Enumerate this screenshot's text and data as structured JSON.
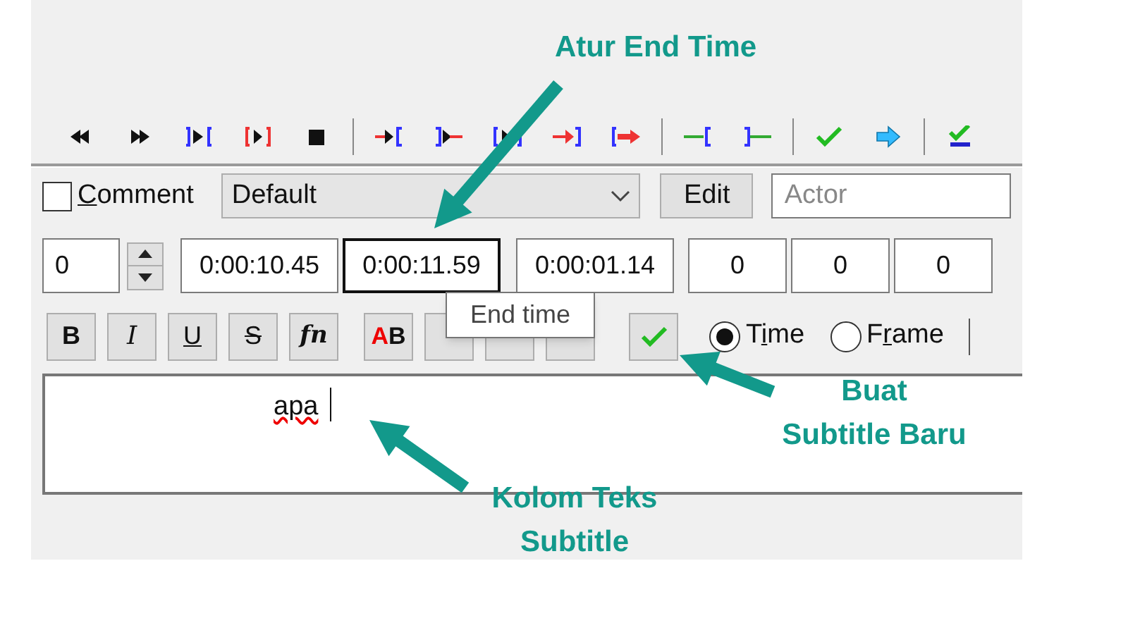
{
  "annotations": [
    {
      "kind": "end_time",
      "lines": [
        "Atur End Time"
      ]
    },
    {
      "kind": "commit",
      "lines": [
        "Buat",
        "Subtitle Baru"
      ]
    },
    {
      "kind": "text_box",
      "lines": [
        "Kolom Teks",
        "Subtitle"
      ]
    }
  ],
  "comment": {
    "accel": "C",
    "after": "omment",
    "checked": false
  },
  "style_select": {
    "value": "Default"
  },
  "edit_button": "Edit",
  "actor": {
    "placeholder": "Actor"
  },
  "layer": "0",
  "times": [
    {
      "value": "0:00:10.45",
      "focused": false
    },
    {
      "value": "0:00:11.59",
      "focused": true
    },
    {
      "value": "0:00:01.14",
      "focused": false
    }
  ],
  "margins": [
    "0",
    "0",
    "0"
  ],
  "tooltip": "End time",
  "format_buttons": [
    {
      "kind": "bold",
      "label": "B"
    },
    {
      "kind": "italic",
      "label": "I"
    },
    {
      "kind": "underline",
      "label": "U"
    },
    {
      "kind": "strike",
      "label": "S"
    },
    {
      "kind": "font",
      "label": "fn"
    },
    {
      "kind": "color",
      "label": "A",
      "suffix": "B"
    },
    {
      "kind": "blank"
    },
    {
      "kind": "blank"
    },
    {
      "kind": "blank"
    },
    {
      "kind": "commit"
    }
  ],
  "radios": [
    {
      "before": "T",
      "accel": "i",
      "after": "me",
      "selected": true
    },
    {
      "before": "F",
      "accel": "r",
      "after": "ame",
      "selected": false
    }
  ],
  "text": {
    "value": "apa"
  }
}
